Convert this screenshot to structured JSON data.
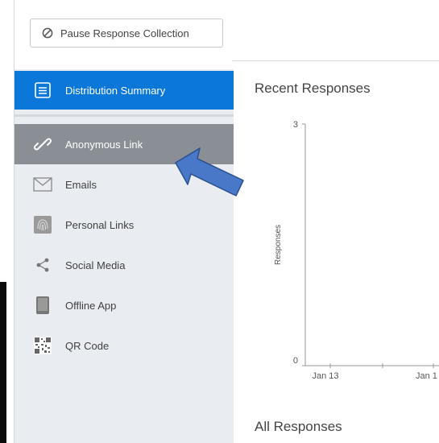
{
  "toolbar": {
    "pause_label": "Pause Response Collection"
  },
  "sidebar": {
    "summary": {
      "label": "Distribution Summary"
    },
    "items": [
      {
        "label": "Anonymous Link",
        "icon": "link-icon"
      },
      {
        "label": "Emails",
        "icon": "envelope-icon"
      },
      {
        "label": "Personal Links",
        "icon": "fingerprint-icon"
      },
      {
        "label": "Social Media",
        "icon": "share-icon"
      },
      {
        "label": "Offline App",
        "icon": "tablet-icon"
      },
      {
        "label": "QR Code",
        "icon": "qr-code-icon"
      }
    ]
  },
  "main": {
    "recent_title": "Recent Responses",
    "all_title": "All Responses"
  },
  "colors": {
    "active_bg": "#0b77d8",
    "selected_bg": "#8a8f96",
    "sidebar_bg": "#e9edf1",
    "arrow_fill": "#4a78c9"
  },
  "chart_data": {
    "type": "line",
    "title": "Recent Responses",
    "xlabel": "",
    "ylabel": "Responses",
    "ylim": [
      0,
      3
    ],
    "yticks": [
      "0",
      "3"
    ],
    "categories": [
      "Jan 13",
      "Jan 1"
    ],
    "series": [],
    "grid": false
  }
}
